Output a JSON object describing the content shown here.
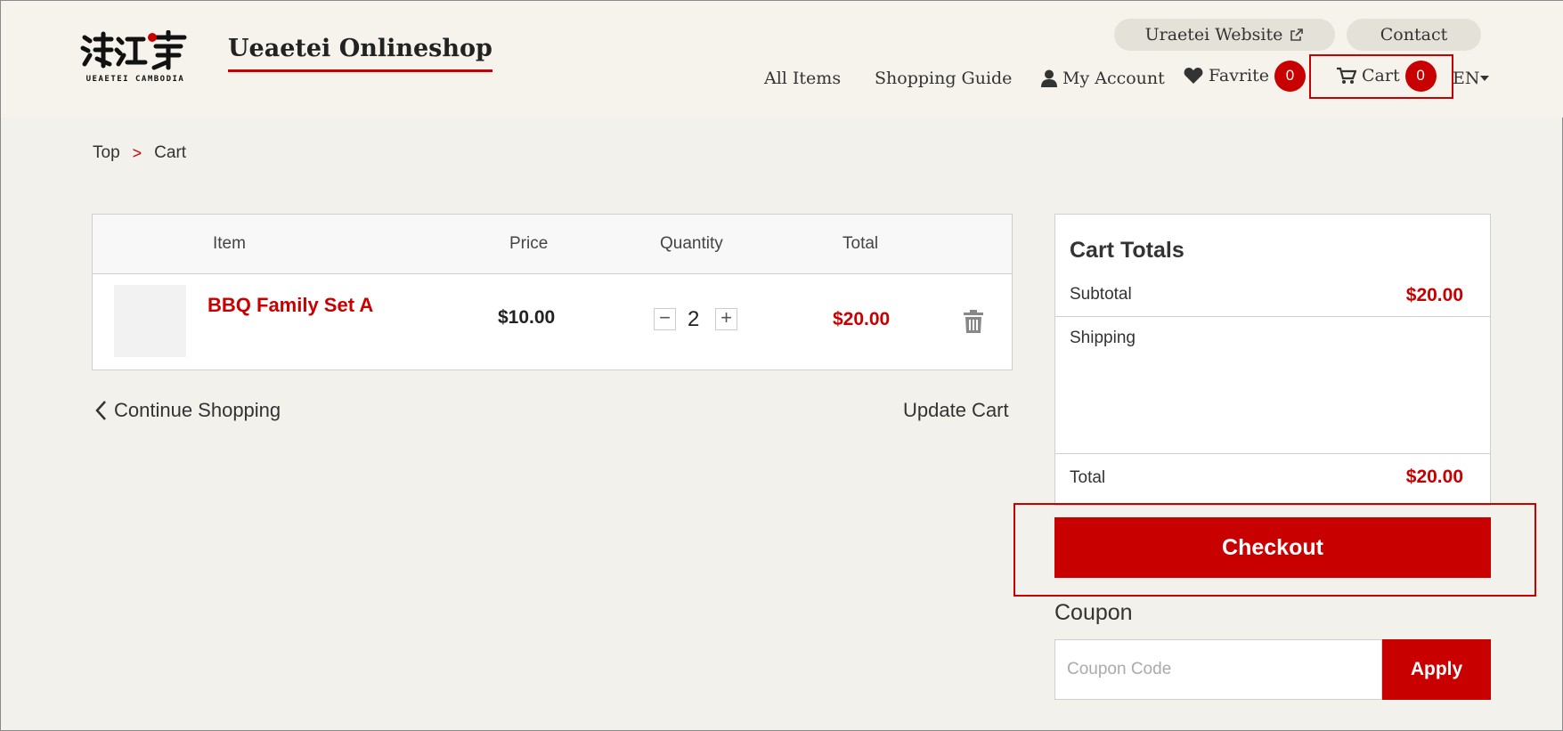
{
  "header": {
    "logo_alt": "UEAETEI CAMBODIA",
    "logo_colors": {
      "ink": "#111111",
      "accent": "#c80000"
    },
    "shop_title": "Ueaetei Onlineshop",
    "website_label": "Uraetei Website",
    "contact_label": "Contact",
    "nav": {
      "all_items": "All Items",
      "shopping_guide": "Shopping Guide",
      "my_account": "My Account",
      "favorite": "Favrite",
      "favorite_count": "0",
      "cart": "Cart",
      "cart_count": "0",
      "language": "EN"
    }
  },
  "breadcrumb": {
    "top": "Top",
    "separator": ">",
    "current": "Cart"
  },
  "cart_table": {
    "headers": {
      "item": "Item",
      "price": "Price",
      "quantity": "Quantity",
      "total": "Total"
    },
    "items": [
      {
        "name": "BBQ Family Set A",
        "price": "$10.00",
        "quantity": "2",
        "total": "$20.00"
      }
    ]
  },
  "actions": {
    "continue_shopping": "Continue Shopping",
    "update_cart": "Update Cart"
  },
  "totals": {
    "title": "Cart Totals",
    "subtotal_label": "Subtotal",
    "subtotal_value": "$20.00",
    "shipping_label": "Shipping",
    "total_label": "Total",
    "total_value": "$20.00",
    "checkout_label": "Checkout"
  },
  "coupon": {
    "label": "Coupon",
    "placeholder": "Coupon Code",
    "apply_label": "Apply"
  },
  "colors": {
    "accent": "#c80000",
    "background": "#f3f1ec"
  }
}
